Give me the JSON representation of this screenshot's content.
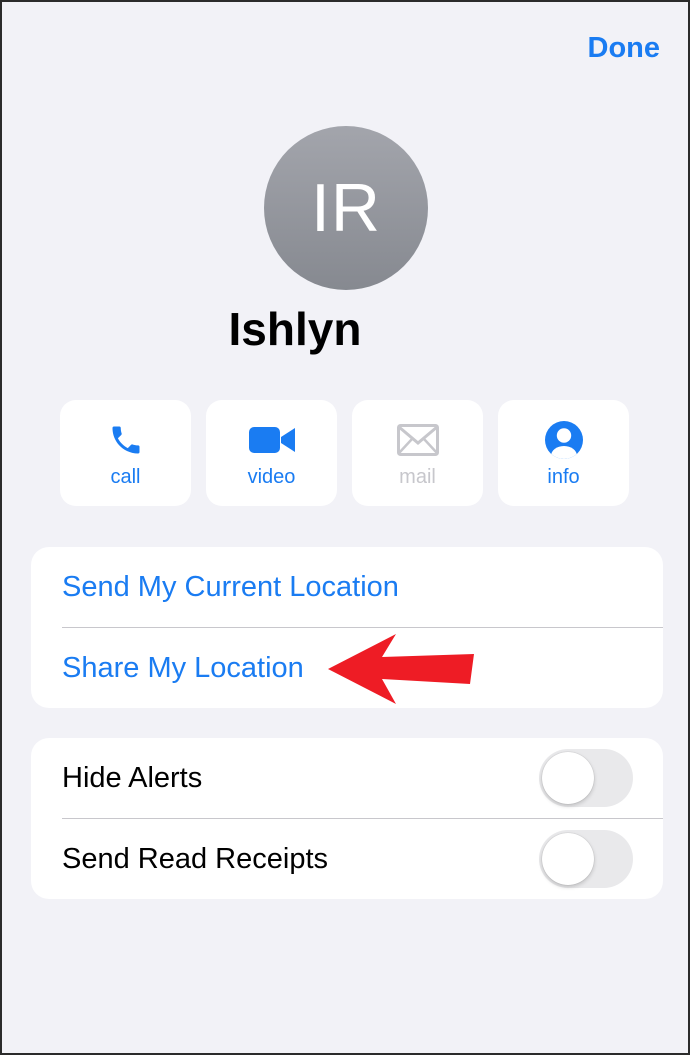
{
  "nav": {
    "done_label": "Done"
  },
  "contact": {
    "initials": "IR",
    "name": "Ishlyn"
  },
  "actions": [
    {
      "label": "call",
      "icon": "phone-icon",
      "enabled": true
    },
    {
      "label": "video",
      "icon": "video-camera-icon",
      "enabled": true
    },
    {
      "label": "mail",
      "icon": "envelope-icon",
      "enabled": false
    },
    {
      "label": "info",
      "icon": "person-circle-icon",
      "enabled": true
    }
  ],
  "location_group": {
    "items": [
      {
        "label": "Send My Current Location"
      },
      {
        "label": "Share My Location"
      }
    ]
  },
  "settings_group": {
    "items": [
      {
        "label": "Hide Alerts",
        "enabled": false
      },
      {
        "label": "Send Read Receipts",
        "enabled": false
      }
    ]
  },
  "colors": {
    "accent": "#1a7cf2",
    "background": "#f2f2f7",
    "disabled": "#c7c7cc",
    "annotation_arrow": "#ee1c25"
  }
}
